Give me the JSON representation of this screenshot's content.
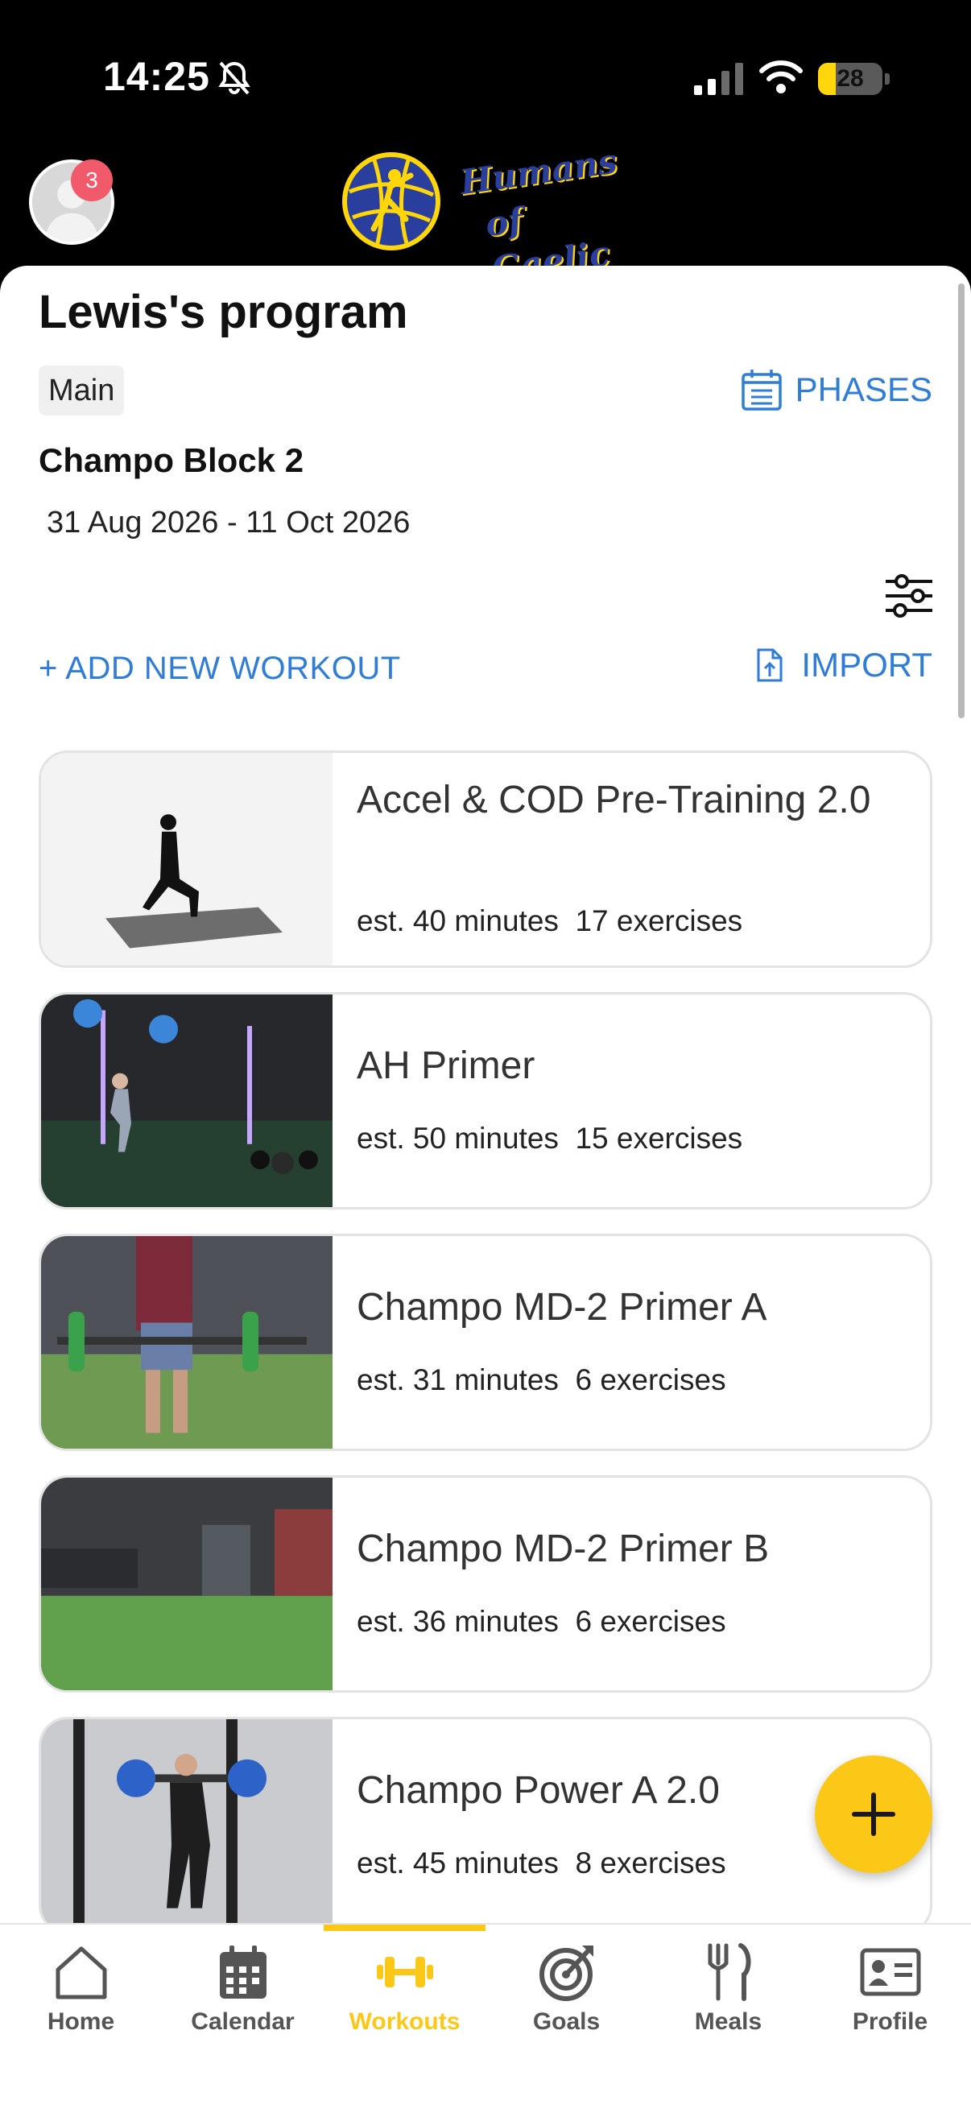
{
  "status_bar": {
    "time": "14:25",
    "battery_level": 28,
    "battery_text": "28",
    "icons": [
      "bell-slash-icon",
      "cellular-signal-icon",
      "wifi-icon",
      "battery-icon"
    ]
  },
  "header": {
    "notification_count": "3",
    "brand_line1": "Humans",
    "brand_line2": "of Gaelic"
  },
  "program": {
    "title": "Lewis's program",
    "chip": "Main",
    "phases_label": "PHASES",
    "block_name": "Champo Block 2",
    "block_dates": "31 Aug 2026 - 11 Oct 2026",
    "add_workout_label": "+ ADD NEW WORKOUT",
    "import_label": "IMPORT"
  },
  "workouts": [
    {
      "name": "Accel & COD Pre-Training 2.0",
      "meta": "est. 40 minutes  17 exercises"
    },
    {
      "name": "AH Primer",
      "meta": "est. 50 minutes  15 exercises"
    },
    {
      "name": "Champo MD-2 Primer A",
      "meta": "est. 31 minutes  6 exercises"
    },
    {
      "name": "Champo MD-2 Primer B",
      "meta": "est. 36 minutes  6 exercises"
    },
    {
      "name": "Champo Power A 2.0",
      "meta": "est. 45 minutes  8 exercises"
    }
  ],
  "bottom_nav": {
    "active": "Workouts",
    "items": [
      {
        "label": "Home",
        "icon": "home-icon"
      },
      {
        "label": "Calendar",
        "icon": "calendar-icon"
      },
      {
        "label": "Workouts",
        "icon": "dumbbell-icon"
      },
      {
        "label": "Goals",
        "icon": "target-icon"
      },
      {
        "label": "Meals",
        "icon": "fork-knife-icon"
      },
      {
        "label": "Profile",
        "icon": "id-card-icon"
      }
    ]
  },
  "colors": {
    "accent": "#fbc818",
    "link_blue": "#2f7dd6",
    "badge_red": "#f05a6a"
  }
}
